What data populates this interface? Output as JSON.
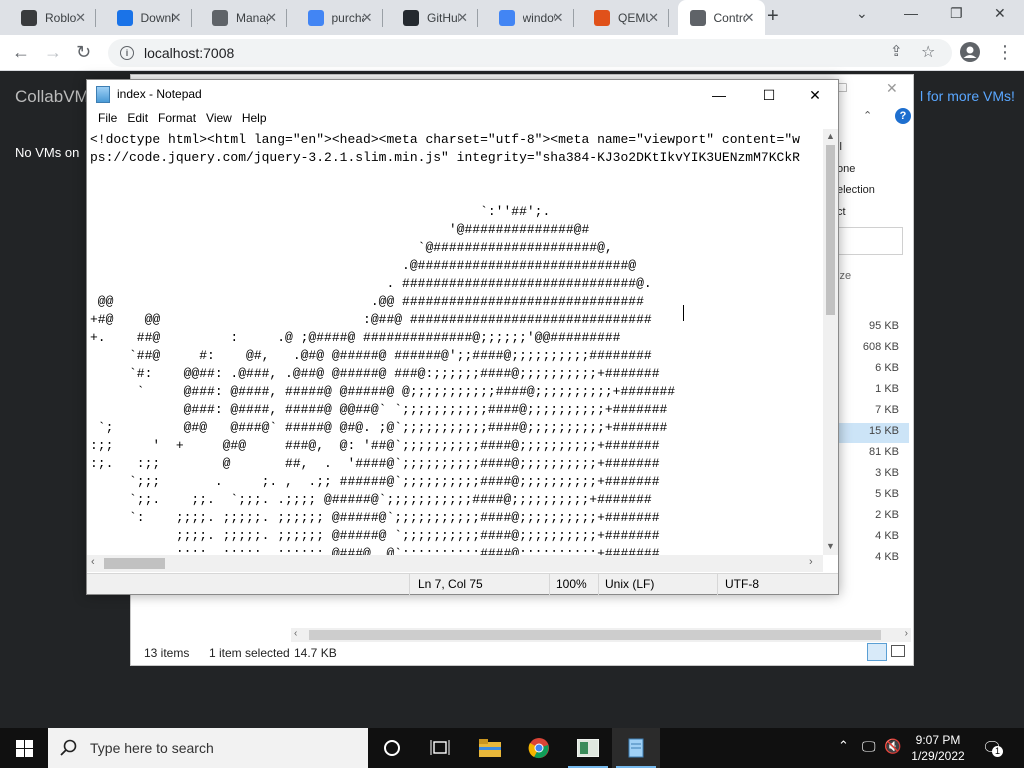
{
  "browser": {
    "tabs": [
      {
        "title": "Roblox",
        "favicon": "roblox-icon",
        "color": "#393b3d"
      },
      {
        "title": "Downloads",
        "favicon": "download-page-icon",
        "color": "#1a73e8"
      },
      {
        "title": "Manage",
        "favicon": "manage-icon",
        "color": "#5f6368"
      },
      {
        "title": "purchase",
        "favicon": "google-icon",
        "color": "#4285f4"
      },
      {
        "title": "GitHub",
        "favicon": "github-icon",
        "color": "#24292f"
      },
      {
        "title": "windows",
        "favicon": "google-icon",
        "color": "#4285f4"
      },
      {
        "title": "QEMU",
        "favicon": "qemu-icon",
        "color": "#e0511a"
      },
      {
        "title": "Control",
        "favicon": "globe-icon",
        "color": "#5f6368",
        "active": true
      }
    ],
    "url": "localhost:7008"
  },
  "page": {
    "title": "CollabVM",
    "no_vms": "No VMs on",
    "more_link": "l for more VMs!"
  },
  "explorer": {
    "right_partial": [
      "ll",
      "one",
      "election",
      "ct"
    ],
    "size_col": "ize",
    "sizes": [
      "95 KB",
      "608 KB",
      "6 KB",
      "1 KB",
      "7 KB",
      "15 KB",
      "81 KB",
      "3 KB",
      "5 KB",
      "2 KB",
      "4 KB",
      "4 KB"
    ],
    "status_items": "13 items",
    "status_selected": "1 item selected",
    "status_size": "14.7 KB"
  },
  "notepad": {
    "title": "index - Notepad",
    "menu": [
      "File",
      "Edit",
      "Format",
      "View",
      "Help"
    ],
    "text": "<!doctype html><html lang=\"en\"><head><meta charset=\"utf-8\"><meta name=\"viewport\" content=\"w\nps://code.jquery.com/jquery-3.2.1.slim.min.js\" integrity=\"sha384-KJ3o2DKtIkvYIK3UENzmM7KCkR\n\n\n                                                  `:''##';.\n                                              '@##############@#\n                                          `@#####################@,\n                                        .@###########################@\n                                      . ##############################@.\n @@                                 .@@ ###############################\n+#@    @@                          :@##@ ###############################\n+.    ##@         :     .@ ;@####@ ##############@;;;;;;'@@#########\n     `##@     #:    @#,   .@#@ @#####@ ######@';;####@;;;;;;;;;;########\n     `#:    @@##: .@###, .@##@ @#####@ ###@:;;;;;;####@;;;;;;;;;;+#######\n      `     @###: @####, #####@ @#####@ @;;;;;;;;;;;####@;;;;;;;;;;+#######\n            @###: @####, #####@ @@##@` `;;;;;;;;;;;####@;;;;;;;;;;+#######\n `;         @#@   @###@` #####@ @#@. ;@`;;;;;;;;;;;####@;;;;;;;;;;+#######\n:;;     '  +     @#@     ###@,  @: '##@`;;;;;;;;;;####@;;;;;;;;;;+#######\n:;.   :;;        @       ##,  .  '####@`;;;;;;;;;;####@;;;;;;;;;;+#######\n     `;;;       .     ;. ,  .;; ######@`;;;;;;;;;;####@;;;;;;;;;;+#######\n     `;;.    ;;.  `;;;. .;;;; @#####@`;;;;;;;;;;;####@;;;;;;;;;;+#######\n     `:    ;;;;. ;;;;;. ;;;;;; @#####@`;;;;;;;;;;;####@;;;;;;;;;;+#######\n           ;;;;. ;;;;;. ;;;;;; @#####@ `;;;;;;;;;;####@;;;;;;;;;;+#######\n  .        ;;;;  ;;;;;  ;;;;;; @###@  @`;;;;;;;;;;####@;;;;;;;;;;+#######",
    "status": {
      "position": "Ln 7, Col 75",
      "zoom": "100%",
      "line_endings": "Unix (LF)",
      "encoding": "UTF-8"
    }
  },
  "taskbar": {
    "search_placeholder": "Type here to search",
    "time": "9:07 PM",
    "date": "1/29/2022",
    "notification_count": "1"
  }
}
